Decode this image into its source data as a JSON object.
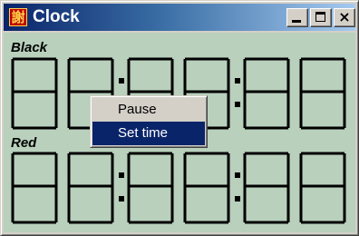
{
  "window": {
    "title": "Clock",
    "icon": "chinese-character-app-icon",
    "icon_glyph": "謝",
    "controls": {
      "minimize": "minimize-icon",
      "maximize": "maximize-icon",
      "close": "close-icon",
      "close_glyph": "×"
    }
  },
  "clocks": {
    "black": {
      "label": "Black",
      "digits": [
        "8",
        "8",
        "8",
        "8",
        "8",
        "8"
      ]
    },
    "red": {
      "label": "Red",
      "digits": [
        "8",
        "8",
        "8",
        "8",
        "8",
        "8"
      ]
    }
  },
  "context_menu": {
    "items": [
      {
        "label": "Pause",
        "highlighted": false
      },
      {
        "label": "Set time",
        "highlighted": true
      }
    ]
  },
  "colors": {
    "display_background": "#b8d0bc",
    "titlebar_start": "#0a246a",
    "titlebar_end": "#a6caf0",
    "menu_highlight": "#0a246a"
  }
}
